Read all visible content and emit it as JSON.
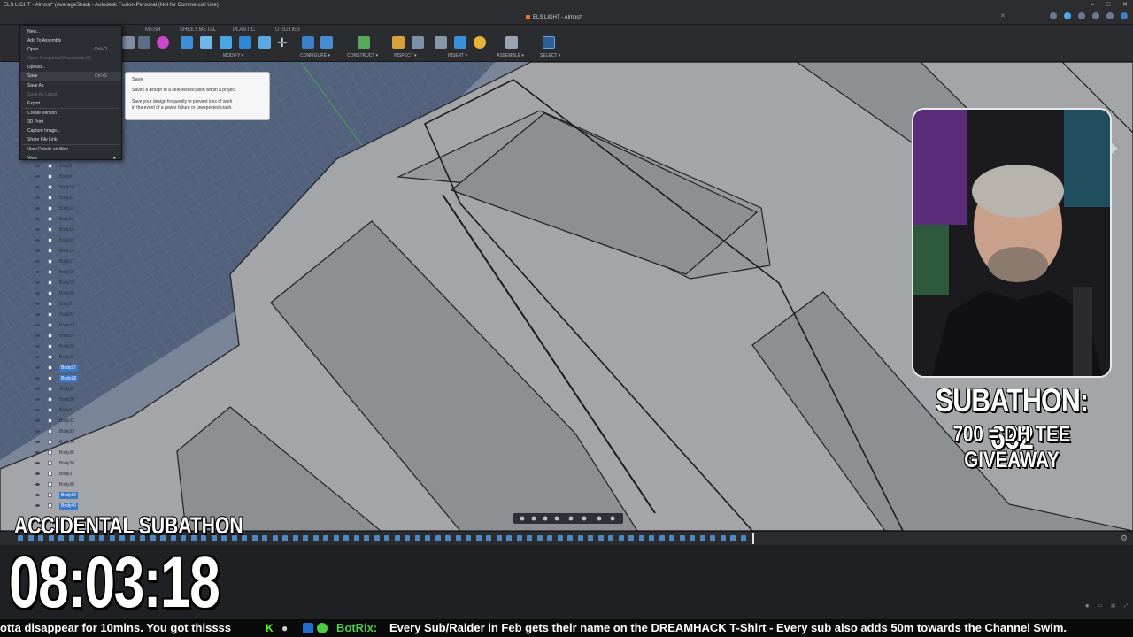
{
  "window": {
    "title": "ELS LIGHT - Almost* (AverageShad) - Autodesk Fusion Personal (Not for Commercial Use)",
    "doc_tab": "ELS LIGHT - Almost*"
  },
  "ribbon": {
    "tabs": [
      "MESH",
      "SHEET METAL",
      "PLASTIC",
      "UTILITIES"
    ],
    "groups": [
      "MODIFY ▾",
      "CONFIGURE ▾",
      "CONSTRUCT ▾",
      "INSPECT ▾",
      "INSERT ▾",
      "ASSEMBLE ▾",
      "SELECT ▾"
    ]
  },
  "file_menu": {
    "items": [
      {
        "label": "New...",
        "shortcut": "",
        "disabled": false
      },
      {
        "label": "Add To Assembly",
        "shortcut": "",
        "disabled": false
      },
      {
        "label": "Open...",
        "shortcut": "Ctrl+O",
        "disabled": false
      },
      {
        "label": "Open Recovered Documents (0)",
        "shortcut": "",
        "disabled": true
      },
      {
        "label": "Upload...",
        "shortcut": "",
        "disabled": false
      },
      {
        "label": "Save",
        "shortcut": "Ctrl+S",
        "disabled": false,
        "hover": true
      },
      {
        "label": "Save As",
        "shortcut": "",
        "disabled": false
      },
      {
        "label": "Save As Latest",
        "shortcut": "",
        "disabled": true
      },
      {
        "label": "Export...",
        "shortcut": "",
        "disabled": false
      },
      {
        "label": "Create Version",
        "shortcut": "",
        "disabled": false
      },
      {
        "label": "3D Print",
        "shortcut": "",
        "disabled": false
      },
      {
        "label": "Capture Image...",
        "shortcut": "",
        "disabled": false
      },
      {
        "label": "Share File Link",
        "shortcut": "",
        "disabled": false
      },
      {
        "label": "View Details on Web",
        "shortcut": "",
        "disabled": false
      },
      {
        "label": "View",
        "shortcut": "",
        "disabled": false,
        "submenu": true
      }
    ]
  },
  "tooltip": {
    "title": "Save",
    "line1": "Saves a design to a selected location within a project.",
    "line2": "Save your design frequently to prevent loss of work",
    "line3": "in the event of a power failure or unexpected crash."
  },
  "browser_bodies": [
    {
      "label": "Body8",
      "selected": false
    },
    {
      "label": "Body9",
      "selected": false
    },
    {
      "label": "Body10",
      "selected": false
    },
    {
      "label": "Body11",
      "selected": false
    },
    {
      "label": "Body12",
      "selected": false
    },
    {
      "label": "Body13",
      "selected": false
    },
    {
      "label": "Body14",
      "selected": false
    },
    {
      "label": "Body15",
      "selected": false
    },
    {
      "label": "Body16",
      "selected": false
    },
    {
      "label": "Body17",
      "selected": false
    },
    {
      "label": "Body18",
      "selected": false
    },
    {
      "label": "Body19",
      "selected": false
    },
    {
      "label": "Body20",
      "selected": false
    },
    {
      "label": "Body21",
      "selected": false
    },
    {
      "label": "Body22",
      "selected": false
    },
    {
      "label": "Body23",
      "selected": false
    },
    {
      "label": "Body24",
      "selected": false
    },
    {
      "label": "Body25",
      "selected": false
    },
    {
      "label": "Body26",
      "selected": false
    },
    {
      "label": "Body27",
      "selected": true
    },
    {
      "label": "Body28",
      "selected": true
    },
    {
      "label": "Body29",
      "selected": false
    },
    {
      "label": "Body30",
      "selected": false
    },
    {
      "label": "Body31",
      "selected": false
    },
    {
      "label": "Body32",
      "selected": false
    },
    {
      "label": "Body33",
      "selected": false
    },
    {
      "label": "Body34",
      "selected": false
    },
    {
      "label": "Body35",
      "selected": false
    },
    {
      "label": "Body36",
      "selected": false
    },
    {
      "label": "Body37",
      "selected": false
    },
    {
      "label": "Body38",
      "selected": false
    },
    {
      "label": "Body39",
      "selected": true
    },
    {
      "label": "Body40",
      "selected": true
    }
  ],
  "overlay": {
    "subathon_count": "SUBATHON: 662",
    "giveaway": "700 = DH TEE GIVEAWAY",
    "accidental_title": "ACCIDENTAL SUBATHON",
    "timer": "08:03:18"
  },
  "ticker": {
    "left_text": "otta disappear for 10mins. You got thissss",
    "bot_name": "BotRix:",
    "message": "Every Sub/Raider in Feb gets their name on the DREAMHACK T-Shirt - Every sub also adds 50m towards the Channel Swim."
  },
  "colors": {
    "accent": "#3b78c9",
    "viewport_bg": "#8e9093",
    "bot_green": "#4ecb49"
  }
}
